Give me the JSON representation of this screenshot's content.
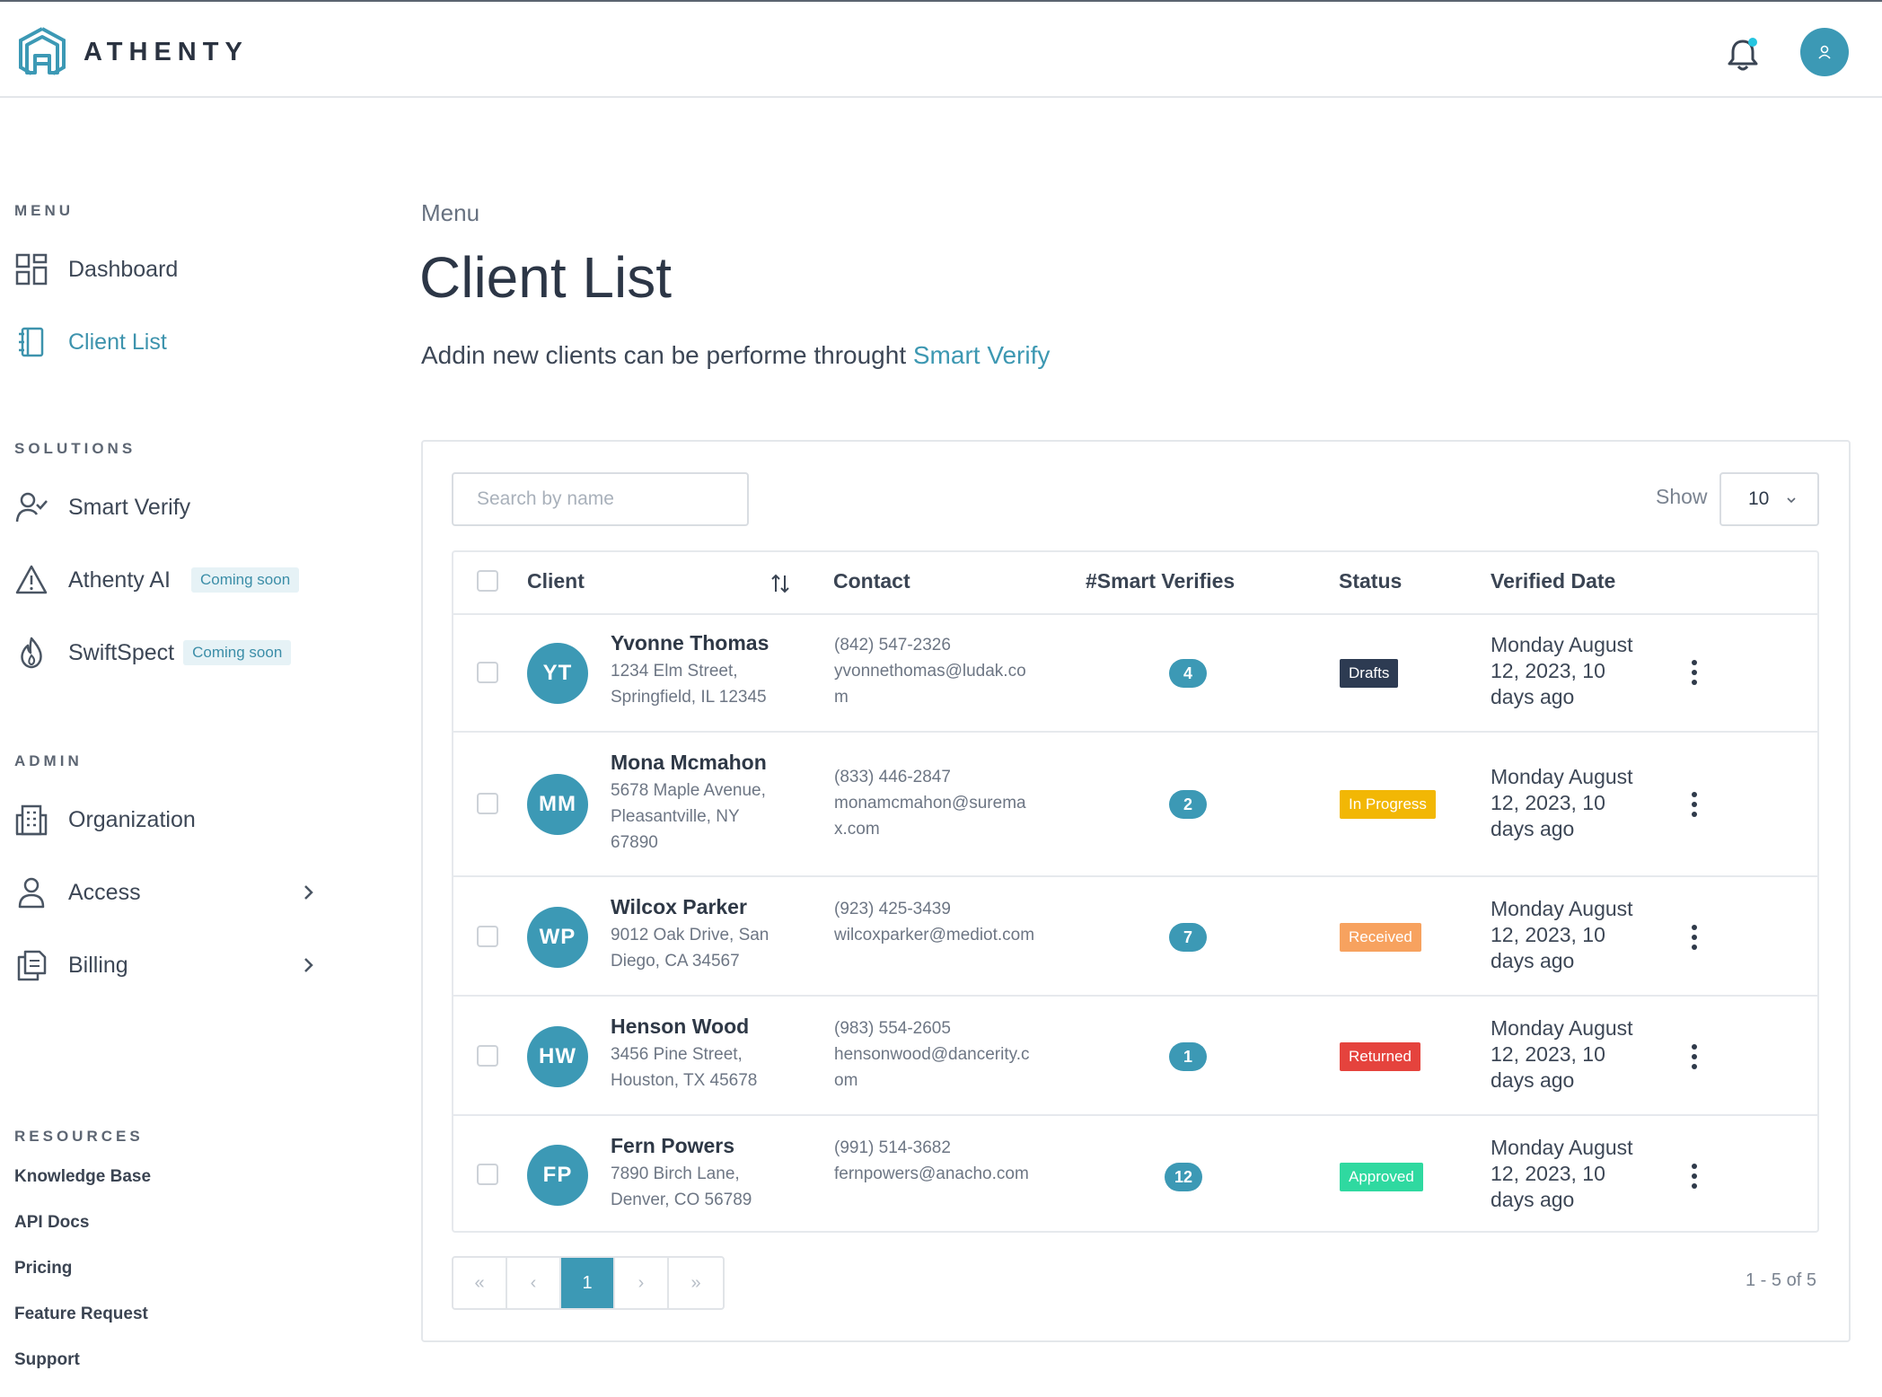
{
  "app": {
    "brand": "ATHENTY"
  },
  "sidebar": {
    "menu_heading": "MENU",
    "menu_items": [
      {
        "label": "Dashboard",
        "icon": "dashboard-icon"
      },
      {
        "label": "Client List",
        "icon": "notebook-icon",
        "active": true
      }
    ],
    "solutions_heading": "SOLUTIONS",
    "solutions_items": [
      {
        "label": "Smart Verify",
        "icon": "user-check-icon"
      },
      {
        "label": "Athenty AI",
        "icon": "warning-triangle-icon",
        "badge": "Coming soon"
      },
      {
        "label": "SwiftSpect",
        "icon": "flame-icon",
        "badge": "Coming soon"
      }
    ],
    "admin_heading": "ADMIN",
    "admin_items": [
      {
        "label": "Organization",
        "icon": "building-icon"
      },
      {
        "label": "Access",
        "icon": "person-icon"
      },
      {
        "label": "Billing",
        "icon": "document-stack-icon"
      }
    ],
    "resources_heading": "RESOURCES",
    "resources_links": [
      "Knowledge Base",
      "API Docs",
      "Pricing",
      "Feature Request",
      "Support"
    ]
  },
  "header": {
    "breadcrumb": "Menu",
    "title": "Client List",
    "subtitle_text": "Addin new clients can be performe throught ",
    "subtitle_link": "Smart Verify"
  },
  "toolbar": {
    "search_placeholder": "Search by name",
    "show_label": "Show",
    "show_value": "10"
  },
  "table": {
    "columns": [
      "Client",
      "Contact",
      "#Smart Verifies",
      "Status",
      "Verified Date"
    ],
    "rows": [
      {
        "initials": "YT",
        "name": "Yvonne Thomas",
        "address": "1234 Elm Street, Springfield, IL 12345",
        "phone": "(842) 547-2326",
        "email": "yvonnethomas@ludak.com",
        "verifies": "4",
        "status": "Drafts",
        "date": "Monday August 12, 2023, 10 days ago"
      },
      {
        "initials": "MM",
        "name": "Mona Mcmahon",
        "address": "5678 Maple Avenue, Pleasantville, NY 67890",
        "phone": "(833) 446-2847",
        "email": "monamcmahon@suremax.com",
        "verifies": "2",
        "status": "In Progress",
        "date": "Monday August 12, 2023, 10 days ago"
      },
      {
        "initials": "WP",
        "name": "Wilcox Parker",
        "address": "9012 Oak Drive, San Diego, CA 34567",
        "phone": "(923) 425-3439",
        "email": "wilcoxparker@mediot.com",
        "verifies": "7",
        "status": "Received",
        "date": "Monday August 12, 2023, 10 days ago"
      },
      {
        "initials": "HW",
        "name": "Henson Wood",
        "address": "3456 Pine Street, Houston, TX 45678",
        "phone": "(983) 554-2605",
        "email": "hensonwood@dancerity.com",
        "verifies": "1",
        "status": "Returned",
        "date": "Monday August 12, 2023, 10 days ago"
      },
      {
        "initials": "FP",
        "name": "Fern Powers",
        "address": "7890 Birch Lane, Denver, CO 56789",
        "phone": "(991) 514-3682",
        "email": "fernpowers@anacho.com",
        "verifies": "12",
        "status": "Approved",
        "date": "Monday August 12, 2023, 10 days ago"
      }
    ]
  },
  "status_colors": {
    "Drafts": "#2d3b52",
    "In Progress": "#f2b705",
    "Received": "#f7a25f",
    "Returned": "#e5433d",
    "Approved": "#2fd9a0"
  },
  "pagination": {
    "first": "«",
    "prev": "‹",
    "current": "1",
    "next": "›",
    "last": "»",
    "range": "1 - 5 of 5"
  },
  "colors": {
    "accent": "#3c99b5",
    "text": "#2f3a4a"
  }
}
